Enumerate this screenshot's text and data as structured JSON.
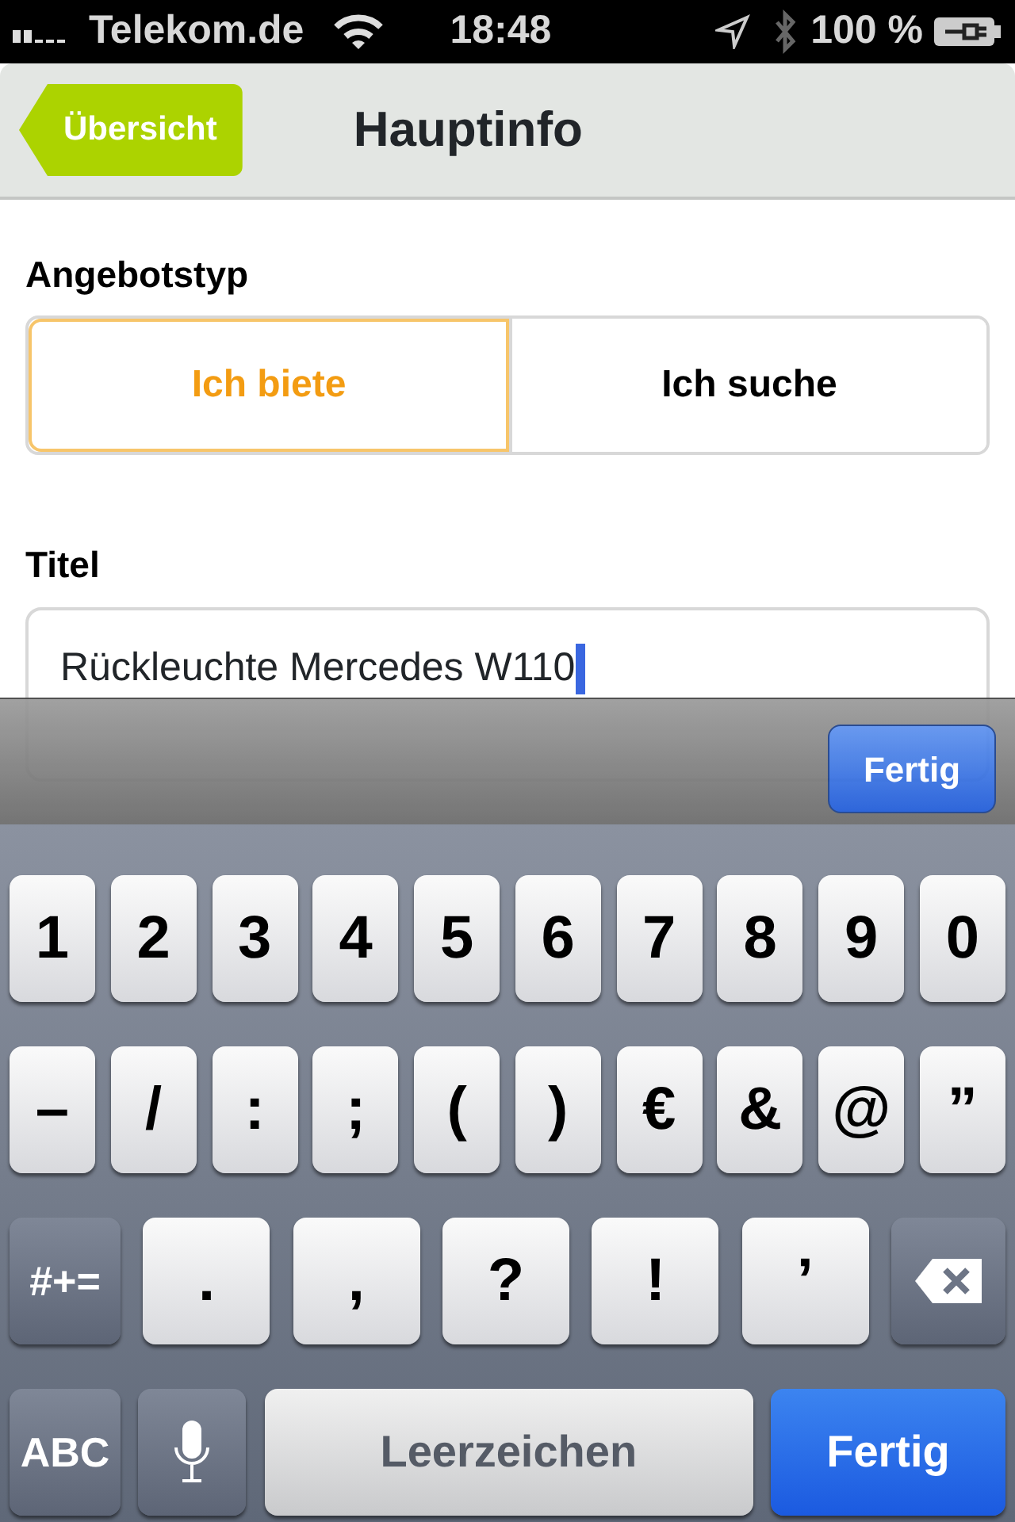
{
  "status_bar": {
    "carrier": "Telekom.de",
    "time": "18:48",
    "battery": "100 %"
  },
  "nav": {
    "back": "Übersicht",
    "title": "Hauptinfo"
  },
  "offer_type": {
    "label": "Angebotstyp",
    "options": [
      {
        "label": "Ich biete",
        "selected": true
      },
      {
        "label": "Ich suche",
        "selected": false
      }
    ]
  },
  "title_field": {
    "label": "Titel",
    "value": "Rückleuchte Mercedes W110",
    "focused": true
  },
  "toolbar": {
    "done": "Fertig"
  },
  "keyboard": {
    "rows": [
      {
        "keys": [
          {
            "kind": "char",
            "label": "1"
          },
          {
            "kind": "char",
            "label": "2"
          },
          {
            "kind": "char",
            "label": "3"
          },
          {
            "kind": "char",
            "label": "4"
          },
          {
            "kind": "char",
            "label": "5"
          },
          {
            "kind": "char",
            "label": "6"
          },
          {
            "kind": "char",
            "label": "7"
          },
          {
            "kind": "char",
            "label": "8"
          },
          {
            "kind": "char",
            "label": "9"
          },
          {
            "kind": "char",
            "label": "0"
          }
        ]
      },
      {
        "keys": [
          {
            "kind": "char",
            "label": "–"
          },
          {
            "kind": "char",
            "label": "/"
          },
          {
            "kind": "char",
            "label": ":"
          },
          {
            "kind": "char",
            "label": ";"
          },
          {
            "kind": "char",
            "label": "("
          },
          {
            "kind": "char",
            "label": ")"
          },
          {
            "kind": "char",
            "label": "€"
          },
          {
            "kind": "char",
            "label": "&"
          },
          {
            "kind": "char",
            "label": "@"
          },
          {
            "kind": "char",
            "label": "”"
          }
        ]
      },
      {
        "keys": [
          {
            "kind": "function",
            "label": "#+="
          },
          {
            "kind": "char",
            "label": "."
          },
          {
            "kind": "char",
            "label": ","
          },
          {
            "kind": "char",
            "label": "?"
          },
          {
            "kind": "char",
            "label": "!"
          },
          {
            "kind": "char",
            "label": "’"
          },
          {
            "kind": "delete"
          }
        ]
      },
      {
        "keys": [
          {
            "kind": "function",
            "label": "ABC"
          },
          {
            "kind": "mic"
          },
          {
            "kind": "space",
            "label": "Leerzeichen"
          },
          {
            "kind": "done",
            "label": "Fertig"
          }
        ]
      }
    ]
  }
}
